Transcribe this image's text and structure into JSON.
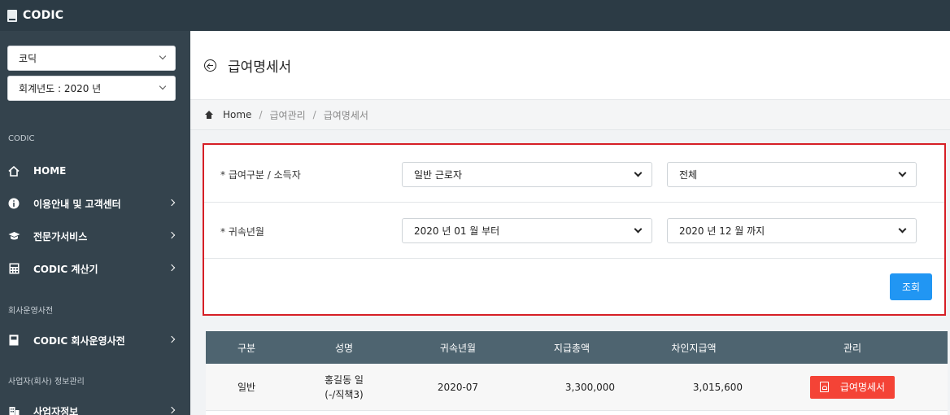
{
  "app": {
    "brand": "CODIC",
    "brand_icon": "book-icon"
  },
  "sidebar": {
    "company_select": "코딕",
    "year_select": "회계년도 : 2020 년",
    "section_codic": "CODIC",
    "items_main": [
      {
        "label": "HOME",
        "icon": "home-icon"
      },
      {
        "label": "이용안내 및 고객센터",
        "icon": "info-icon"
      },
      {
        "label": "전문가서비스",
        "icon": "graduation-cap-icon"
      },
      {
        "label": "CODIC 계산기",
        "icon": "calculator-icon"
      }
    ],
    "section_dictionary": "회사운영사전",
    "items_dictionary": [
      {
        "label": "CODIC 회사운영사전",
        "icon": "book-icon"
      }
    ],
    "section_business": "사업자(회사) 정보관리",
    "items_business": [
      {
        "label": "사업자정보",
        "icon": "building-icon"
      }
    ]
  },
  "page": {
    "title": "급여명세서"
  },
  "breadcrumb": {
    "home": "Home",
    "level1": "급여관리",
    "level2": "급여명세서",
    "separator": "/"
  },
  "filter": {
    "row1_label": "* 급여구분 / 소득자",
    "pay_type": "일반 근로자",
    "earner": "전체",
    "row2_label": "* 귀속년월",
    "from_month": "2020 년 01 월 부터",
    "to_month": "2020 년 12 월 까지",
    "search_label": "조회"
  },
  "table": {
    "headers": [
      "구분",
      "성명",
      "귀속년월",
      "지급총액",
      "차인지급액",
      "관리"
    ],
    "rows": [
      {
        "type": "일반",
        "name_line1": "홍길동 일",
        "name_line2": "(-/직책3)",
        "month": "2020-07",
        "gross": "3,300,000",
        "net": "3,015,600",
        "action": "급여명세서"
      }
    ]
  },
  "colors": {
    "topbar": "#2c3b45",
    "sidebar": "#34434d",
    "accent_blue": "#2196f3",
    "accent_red": "#f44336",
    "highlight_border": "#d61f26",
    "table_header": "#4e6470"
  }
}
